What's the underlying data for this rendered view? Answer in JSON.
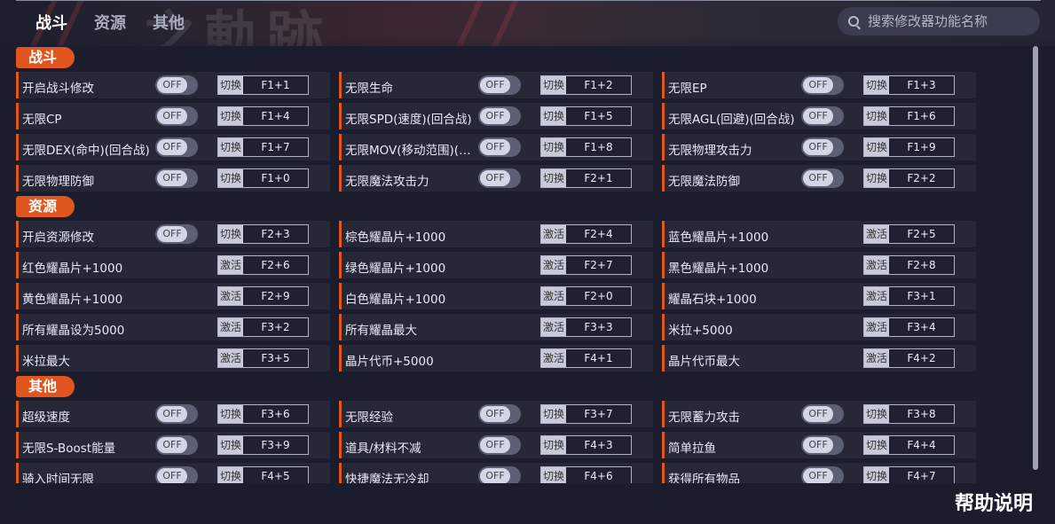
{
  "tabs": [
    "战斗",
    "资源",
    "其他"
  ],
  "search": {
    "placeholder": "搜索修改器功能名称"
  },
  "header_art_text": "之軌跡",
  "help_label": "帮助说明",
  "colors": {
    "accent": "#e0561e",
    "background": "#1b1d2c",
    "card": "#262838"
  },
  "sections": [
    {
      "title": "战斗",
      "rows": [
        [
          {
            "label": "开启战斗修改",
            "toggle": "OFF",
            "action": "切换",
            "key": "F1+1"
          },
          {
            "label": "无限生命",
            "toggle": "OFF",
            "action": "切换",
            "key": "F1+2"
          },
          {
            "label": "无限EP",
            "toggle": "OFF",
            "action": "切换",
            "key": "F1+3"
          }
        ],
        [
          {
            "label": "无限CP",
            "toggle": "OFF",
            "action": "切换",
            "key": "F1+4"
          },
          {
            "label": "无限SPD(速度)(回合战)",
            "toggle": "OFF",
            "action": "切换",
            "key": "F1+5"
          },
          {
            "label": "无限AGL(回避)(回合战)",
            "toggle": "OFF",
            "action": "切换",
            "key": "F1+6"
          }
        ],
        [
          {
            "label": "无限DEX(命中)(回合战)",
            "toggle": "OFF",
            "action": "切换",
            "key": "F1+7"
          },
          {
            "label": "无限MOV(移动范围)(…",
            "toggle": "OFF",
            "action": "切换",
            "key": "F1+8"
          },
          {
            "label": "无限物理攻击力",
            "toggle": "OFF",
            "action": "切换",
            "key": "F1+9"
          }
        ],
        [
          {
            "label": "无限物理防御",
            "toggle": "OFF",
            "action": "切换",
            "key": "F1+0"
          },
          {
            "label": "无限魔法攻击力",
            "toggle": "OFF",
            "action": "切换",
            "key": "F2+1"
          },
          {
            "label": "无限魔法防御",
            "toggle": "OFF",
            "action": "切换",
            "key": "F2+2"
          }
        ]
      ]
    },
    {
      "title": "资源",
      "rows": [
        [
          {
            "label": "开启资源修改",
            "toggle": "OFF",
            "action": "切换",
            "key": "F2+3"
          },
          {
            "label": "棕色耀晶片+1000",
            "toggle": null,
            "action": "激活",
            "key": "F2+4"
          },
          {
            "label": "蓝色耀晶片+1000",
            "toggle": null,
            "action": "激活",
            "key": "F2+5"
          }
        ],
        [
          {
            "label": "红色耀晶片+1000",
            "toggle": null,
            "action": "激活",
            "key": "F2+6"
          },
          {
            "label": "绿色耀晶片+1000",
            "toggle": null,
            "action": "激活",
            "key": "F2+7"
          },
          {
            "label": "黑色耀晶片+1000",
            "toggle": null,
            "action": "激活",
            "key": "F2+8"
          }
        ],
        [
          {
            "label": "黄色耀晶片+1000",
            "toggle": null,
            "action": "激活",
            "key": "F2+9"
          },
          {
            "label": "白色耀晶片+1000",
            "toggle": null,
            "action": "激活",
            "key": "F2+0"
          },
          {
            "label": "耀晶石块+1000",
            "toggle": null,
            "action": "激活",
            "key": "F3+1"
          }
        ],
        [
          {
            "label": "所有耀晶设为5000",
            "toggle": null,
            "action": "激活",
            "key": "F3+2"
          },
          {
            "label": "所有耀晶最大",
            "toggle": null,
            "action": "激活",
            "key": "F3+3"
          },
          {
            "label": "米拉+5000",
            "toggle": null,
            "action": "激活",
            "key": "F3+4"
          }
        ],
        [
          {
            "label": "米拉最大",
            "toggle": null,
            "action": "激活",
            "key": "F3+5"
          },
          {
            "label": "晶片代币+5000",
            "toggle": null,
            "action": "激活",
            "key": "F4+1"
          },
          {
            "label": "晶片代币最大",
            "toggle": null,
            "action": "激活",
            "key": "F4+2"
          }
        ]
      ]
    },
    {
      "title": "其他",
      "rows": [
        [
          {
            "label": "超级速度",
            "toggle": "OFF",
            "action": "切换",
            "key": "F3+6"
          },
          {
            "label": "无限经验",
            "toggle": "OFF",
            "action": "切换",
            "key": "F3+7"
          },
          {
            "label": "无限蓄力攻击",
            "toggle": "OFF",
            "action": "切换",
            "key": "F3+8"
          }
        ],
        [
          {
            "label": "无限S-Boost能量",
            "toggle": "OFF",
            "action": "切换",
            "key": "F3+9"
          },
          {
            "label": "道具/材料不减",
            "toggle": "OFF",
            "action": "切换",
            "key": "F4+3"
          },
          {
            "label": "简单拉鱼",
            "toggle": "OFF",
            "action": "切换",
            "key": "F4+4"
          }
        ],
        [
          {
            "label": "骑入时间无限",
            "toggle": "OFF",
            "action": "切换",
            "key": "F4+5"
          },
          {
            "label": "快捷魔法无冷却",
            "toggle": "OFF",
            "action": "切换",
            "key": "F4+6"
          },
          {
            "label": "获得所有物品",
            "toggle": "OFF",
            "action": "切换",
            "key": "F4+7"
          }
        ]
      ]
    }
  ]
}
